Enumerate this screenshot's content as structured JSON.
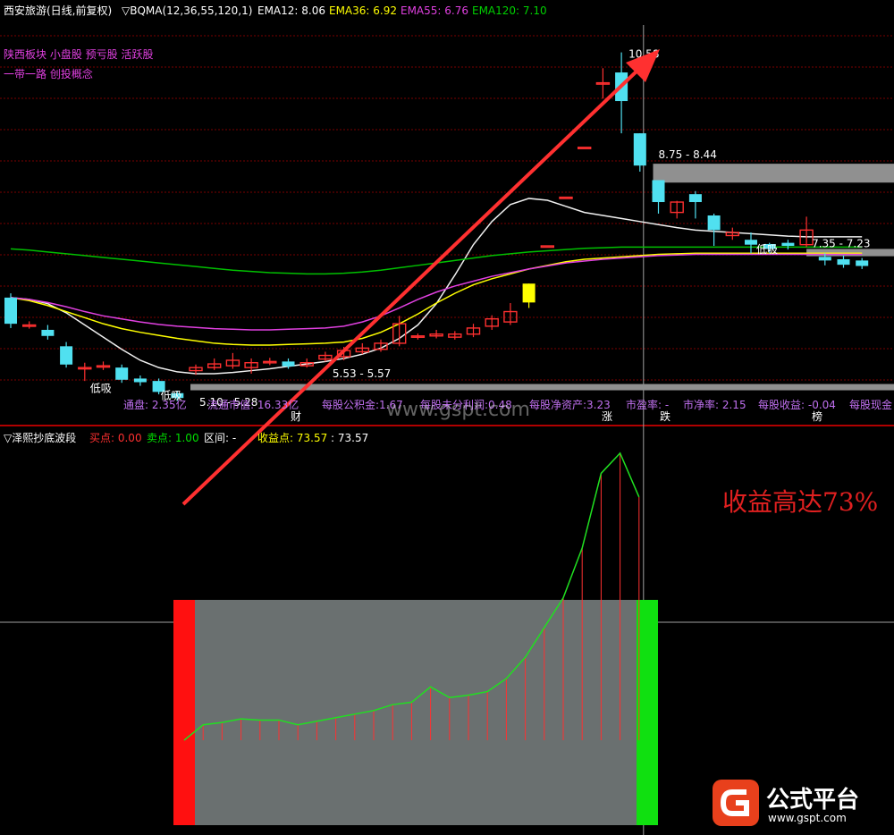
{
  "header": {
    "title": "西安旅游(日线,前复权)",
    "indicator": "▽BQMA(12,36,55,120,1)",
    "ema12_label": "EMA12: 8.06",
    "ema36_label": "EMA36: 6.92",
    "ema55_label": "EMA55: 6.76",
    "ema120_label": "EMA120: 7.10"
  },
  "concepts": {
    "line1": "陕西板块 小盘股 预亏股 活跃股",
    "line2": "一带一路 创投概念"
  },
  "colors": {
    "ema12": "#f0f0f0",
    "ema36": "#ffff00",
    "ema55": "#e040e0",
    "ema120": "#00c000",
    "up": "#ff3030",
    "down": "#50e0f0",
    "arrow": "#ff3030",
    "buy_bar": "#ff1010",
    "sell_bar": "#10e010",
    "zone": "#6a7070"
  },
  "annotations": {
    "peak": "10.58",
    "resistance": "8.75 - 8.44",
    "right_zone": "7.35 - 7.23",
    "support_a": "5.53 - 5.57",
    "support_b": "5.10 - 5.28",
    "tag_low1": "低吸",
    "tag_low2": "低吸",
    "tag_low3": "低吸",
    "tag_cai": "财",
    "tag_zhang": "涨",
    "tag_die": "跌",
    "tag_bang": "榜"
  },
  "stats": {
    "float_shares": "通盘: 2.35亿",
    "float_cap": "流通市值: 16.33亿",
    "reserve": "每股公积金:1.67",
    "undistributed": "每股未分利润:0.48",
    "net_asset": "每股净资产:3.23",
    "pe": "市盈率: -",
    "pb": "市净率: 2.15",
    "eps": "每股收益: -0.04",
    "cash": "每股现金"
  },
  "sub_header": {
    "title": "▽泽熙抄底波段",
    "buy": "买点: 0.00",
    "sell": "卖点: 1.00",
    "interval": "区间: -",
    "profit": "收益点: 73.57",
    "profit_val": ": 73.57"
  },
  "callout": "收益高达73%",
  "watermark": "www.gspt.com",
  "logo": {
    "name": "公式平台",
    "url": "www.gspt.com"
  },
  "chart_data": [
    {
      "type": "candlestick",
      "title": "西安旅游(日线,前复权)",
      "ylim": [
        4.8,
        11.0
      ],
      "candles": [
        {
          "o": 6.55,
          "c": 6.12,
          "h": 6.62,
          "l": 6.05
        },
        {
          "o": 6.1,
          "c": 6.1,
          "h": 6.16,
          "l": 6.04
        },
        {
          "o": 6.02,
          "c": 5.92,
          "h": 6.1,
          "l": 5.86
        },
        {
          "o": 5.75,
          "c": 5.45,
          "h": 5.82,
          "l": 5.4
        },
        {
          "o": 5.4,
          "c": 5.4,
          "h": 5.48,
          "l": 5.18
        },
        {
          "o": 5.43,
          "c": 5.43,
          "h": 5.5,
          "l": 5.36
        },
        {
          "o": 5.4,
          "c": 5.2,
          "h": 5.45,
          "l": 5.15
        },
        {
          "o": 5.22,
          "c": 5.16,
          "h": 5.27,
          "l": 5.1
        },
        {
          "o": 5.18,
          "c": 5.0,
          "h": 5.22,
          "l": 4.96
        },
        {
          "o": 4.98,
          "c": 4.9,
          "h": 5.02,
          "l": 4.85
        },
        {
          "o": 5.35,
          "c": 5.4,
          "h": 5.45,
          "l": 5.28
        },
        {
          "o": 5.4,
          "c": 5.46,
          "h": 5.55,
          "l": 5.36
        },
        {
          "o": 5.43,
          "c": 5.52,
          "h": 5.64,
          "l": 5.38
        },
        {
          "o": 5.4,
          "c": 5.48,
          "h": 5.55,
          "l": 5.3
        },
        {
          "o": 5.5,
          "c": 5.5,
          "h": 5.56,
          "l": 5.44
        },
        {
          "o": 5.5,
          "c": 5.42,
          "h": 5.55,
          "l": 5.38
        },
        {
          "o": 5.43,
          "c": 5.48,
          "h": 5.55,
          "l": 5.4
        },
        {
          "o": 5.54,
          "c": 5.6,
          "h": 5.66,
          "l": 5.5
        },
        {
          "o": 5.58,
          "c": 5.68,
          "h": 5.74,
          "l": 5.52
        },
        {
          "o": 5.66,
          "c": 5.72,
          "h": 5.8,
          "l": 5.62
        },
        {
          "o": 5.7,
          "c": 5.8,
          "h": 5.86,
          "l": 5.66
        },
        {
          "o": 5.8,
          "c": 6.12,
          "h": 6.25,
          "l": 5.75
        },
        {
          "o": 5.92,
          "c": 5.92,
          "h": 5.96,
          "l": 5.86
        },
        {
          "o": 5.92,
          "c": 5.95,
          "h": 6.02,
          "l": 5.88
        },
        {
          "o": 5.9,
          "c": 5.95,
          "h": 6.0,
          "l": 5.86
        },
        {
          "o": 5.95,
          "c": 6.05,
          "h": 6.12,
          "l": 5.9
        },
        {
          "o": 6.08,
          "c": 6.2,
          "h": 6.26,
          "l": 6.02
        },
        {
          "o": 6.15,
          "c": 6.32,
          "h": 6.46,
          "l": 6.1
        },
        {
          "o": 6.47,
          "c": 6.78,
          "h": 6.78,
          "l": 6.38
        },
        {
          "o": 7.4,
          "c": 7.4,
          "h": 7.4,
          "l": 7.4
        },
        {
          "o": 8.2,
          "c": 8.2,
          "h": 8.2,
          "l": 8.2
        },
        {
          "o": 9.02,
          "c": 9.02,
          "h": 9.02,
          "l": 9.02
        },
        {
          "o": 10.08,
          "c": 10.08,
          "h": 10.32,
          "l": 9.82
        },
        {
          "o": 10.25,
          "c": 9.78,
          "h": 10.58,
          "l": 9.25
        },
        {
          "o": 9.25,
          "c": 8.72,
          "h": 9.25,
          "l": 8.62
        },
        {
          "o": 8.48,
          "c": 8.12,
          "h": 8.48,
          "l": 7.93
        },
        {
          "o": 7.95,
          "c": 8.12,
          "h": 8.14,
          "l": 7.85
        },
        {
          "o": 8.25,
          "c": 8.12,
          "h": 8.3,
          "l": 7.85
        },
        {
          "o": 7.9,
          "c": 7.66,
          "h": 7.93,
          "l": 7.4
        },
        {
          "o": 7.57,
          "c": 7.62,
          "h": 7.7,
          "l": 7.5
        },
        {
          "o": 7.5,
          "c": 7.42,
          "h": 7.62,
          "l": 7.28
        },
        {
          "o": 7.43,
          "c": 7.35,
          "h": 7.45,
          "l": 7.28
        },
        {
          "o": 7.45,
          "c": 7.4,
          "h": 7.5,
          "l": 7.34
        },
        {
          "o": 7.42,
          "c": 7.66,
          "h": 7.88,
          "l": 7.38
        },
        {
          "o": 7.22,
          "c": 7.16,
          "h": 7.28,
          "l": 7.08
        },
        {
          "o": 7.18,
          "c": 7.09,
          "h": 7.24,
          "l": 7.04
        },
        {
          "o": 7.16,
          "c": 7.07,
          "h": 7.2,
          "l": 7.02
        }
      ],
      "series": [
        {
          "name": "EMA12",
          "values": [
            6.55,
            6.52,
            6.45,
            6.3,
            6.1,
            5.9,
            5.7,
            5.52,
            5.4,
            5.33,
            5.3,
            5.3,
            5.32,
            5.35,
            5.38,
            5.42,
            5.46,
            5.5,
            5.55,
            5.62,
            5.72,
            5.88,
            6.1,
            6.45,
            6.92,
            7.42,
            7.8,
            8.08,
            8.18,
            8.15,
            8.05,
            7.95,
            7.9,
            7.85,
            7.8,
            7.75,
            7.7,
            7.66,
            7.64,
            7.62,
            7.6,
            7.58,
            7.56,
            7.55,
            7.55,
            7.55,
            7.55
          ]
        },
        {
          "name": "EMA36",
          "values": [
            6.55,
            6.5,
            6.42,
            6.32,
            6.22,
            6.12,
            6.04,
            5.98,
            5.93,
            5.88,
            5.84,
            5.8,
            5.78,
            5.77,
            5.77,
            5.78,
            5.79,
            5.8,
            5.82,
            5.88,
            5.98,
            6.12,
            6.28,
            6.46,
            6.62,
            6.76,
            6.86,
            6.94,
            7.02,
            7.08,
            7.14,
            7.18,
            7.2,
            7.22,
            7.24,
            7.26,
            7.27,
            7.28,
            7.28,
            7.28,
            7.28,
            7.28,
            7.28,
            7.28,
            7.28,
            7.28,
            7.28
          ]
        },
        {
          "name": "EMA55",
          "values": [
            6.55,
            6.52,
            6.47,
            6.4,
            6.32,
            6.25,
            6.2,
            6.15,
            6.11,
            6.08,
            6.06,
            6.04,
            6.03,
            6.02,
            6.02,
            6.03,
            6.04,
            6.05,
            6.08,
            6.15,
            6.25,
            6.38,
            6.52,
            6.64,
            6.74,
            6.82,
            6.9,
            6.96,
            7.02,
            7.07,
            7.12,
            7.15,
            7.18,
            7.2,
            7.22,
            7.24,
            7.25,
            7.26,
            7.26,
            7.26,
            7.26,
            7.26,
            7.26,
            7.26,
            7.26,
            7.26,
            7.26
          ]
        },
        {
          "name": "EMA120",
          "values": [
            7.35,
            7.33,
            7.3,
            7.27,
            7.24,
            7.21,
            7.18,
            7.15,
            7.12,
            7.09,
            7.06,
            7.03,
            7.0,
            6.98,
            6.96,
            6.95,
            6.94,
            6.94,
            6.95,
            6.97,
            7.0,
            7.04,
            7.08,
            7.12,
            7.16,
            7.2,
            7.24,
            7.27,
            7.3,
            7.32,
            7.34,
            7.36,
            7.37,
            7.38,
            7.38,
            7.38,
            7.38,
            7.38,
            7.38,
            7.38,
            7.38,
            7.38,
            7.38,
            7.38,
            7.38,
            7.38,
            7.38
          ]
        }
      ]
    },
    {
      "type": "line",
      "title": "▽泽熙抄底波段",
      "ylim": [
        -30,
        80
      ],
      "values": [
        0,
        13,
        15,
        18,
        17,
        17,
        13,
        16,
        19,
        22,
        25,
        30,
        32,
        45,
        36,
        38,
        41,
        52,
        70,
        95,
        120,
        162,
        225,
        242,
        205
      ]
    }
  ]
}
